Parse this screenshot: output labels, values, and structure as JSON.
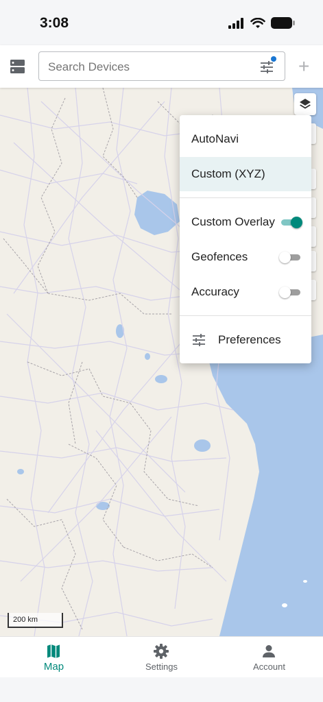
{
  "status_bar": {
    "time": "3:08"
  },
  "search": {
    "placeholder": "Search Devices"
  },
  "map": {
    "scale_label": "200 km"
  },
  "layer_menu": {
    "items": [
      {
        "label": "AutoNavi",
        "selected": false
      },
      {
        "label": "Custom (XYZ)",
        "selected": true
      }
    ],
    "toggles": [
      {
        "label": "Custom Overlay",
        "on": true
      },
      {
        "label": "Geofences",
        "on": false
      },
      {
        "label": "Accuracy",
        "on": false
      }
    ],
    "preferences_label": "Preferences"
  },
  "bottom_nav": {
    "items": [
      {
        "label": "Map",
        "icon": "map-icon",
        "active": true
      },
      {
        "label": "Settings",
        "icon": "gear-icon",
        "active": false
      },
      {
        "label": "Account",
        "icon": "person-icon",
        "active": false
      }
    ]
  },
  "colors": {
    "accent": "#00897b",
    "water": "#a9c6ea",
    "land": "#f2efe8"
  }
}
